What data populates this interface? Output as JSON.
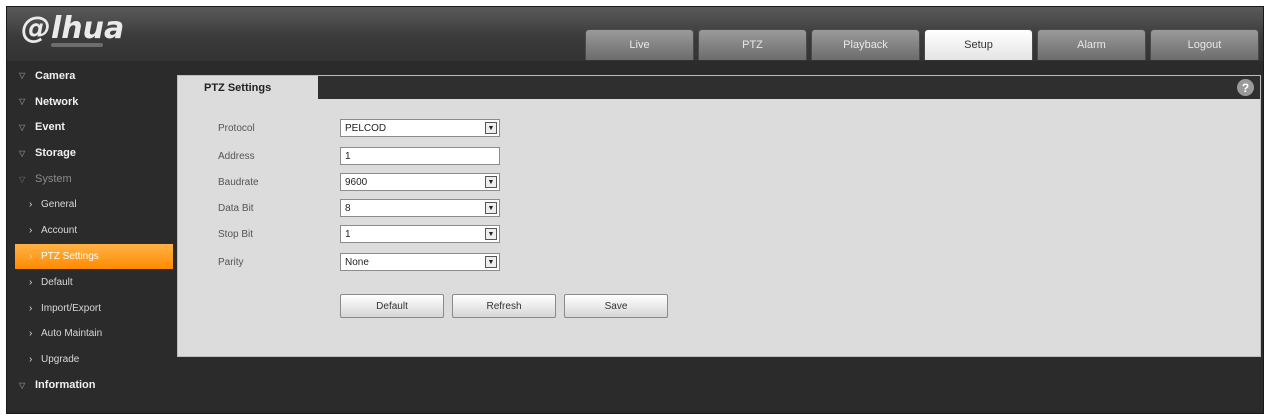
{
  "brand": {
    "logo_text": "@lhua"
  },
  "header": {
    "tabs": [
      {
        "label": "Live"
      },
      {
        "label": "PTZ"
      },
      {
        "label": "Playback"
      },
      {
        "label": "Setup"
      },
      {
        "label": "Alarm"
      },
      {
        "label": "Logout"
      }
    ],
    "active_tab": "Setup"
  },
  "sidebar": {
    "items": [
      {
        "label": "Camera"
      },
      {
        "label": "Network"
      },
      {
        "label": "Event"
      },
      {
        "label": "Storage"
      },
      {
        "label": "System"
      },
      {
        "label": "General"
      },
      {
        "label": "Account"
      },
      {
        "label": "PTZ Settings"
      },
      {
        "label": "Default"
      },
      {
        "label": "Import/Export"
      },
      {
        "label": "Auto Maintain"
      },
      {
        "label": "Upgrade"
      },
      {
        "label": "Information"
      }
    ],
    "selected": "PTZ Settings"
  },
  "page": {
    "title": "PTZ Settings",
    "help_icon": "help-icon",
    "fields": {
      "protocol": {
        "label": "Protocol",
        "value": "PELCOD"
      },
      "address": {
        "label": "Address",
        "value": "1"
      },
      "baudrate": {
        "label": "Baudrate",
        "value": "9600"
      },
      "data_bit": {
        "label": "Data Bit",
        "value": "8"
      },
      "stop_bit": {
        "label": "Stop Bit",
        "value": "1"
      },
      "parity": {
        "label": "Parity",
        "value": "None"
      }
    },
    "buttons": {
      "default": "Default",
      "refresh": "Refresh",
      "save": "Save"
    }
  },
  "colors": {
    "accent": "#ff8a00",
    "background": "#2b2b2b",
    "panel": "#dcdcdc"
  }
}
